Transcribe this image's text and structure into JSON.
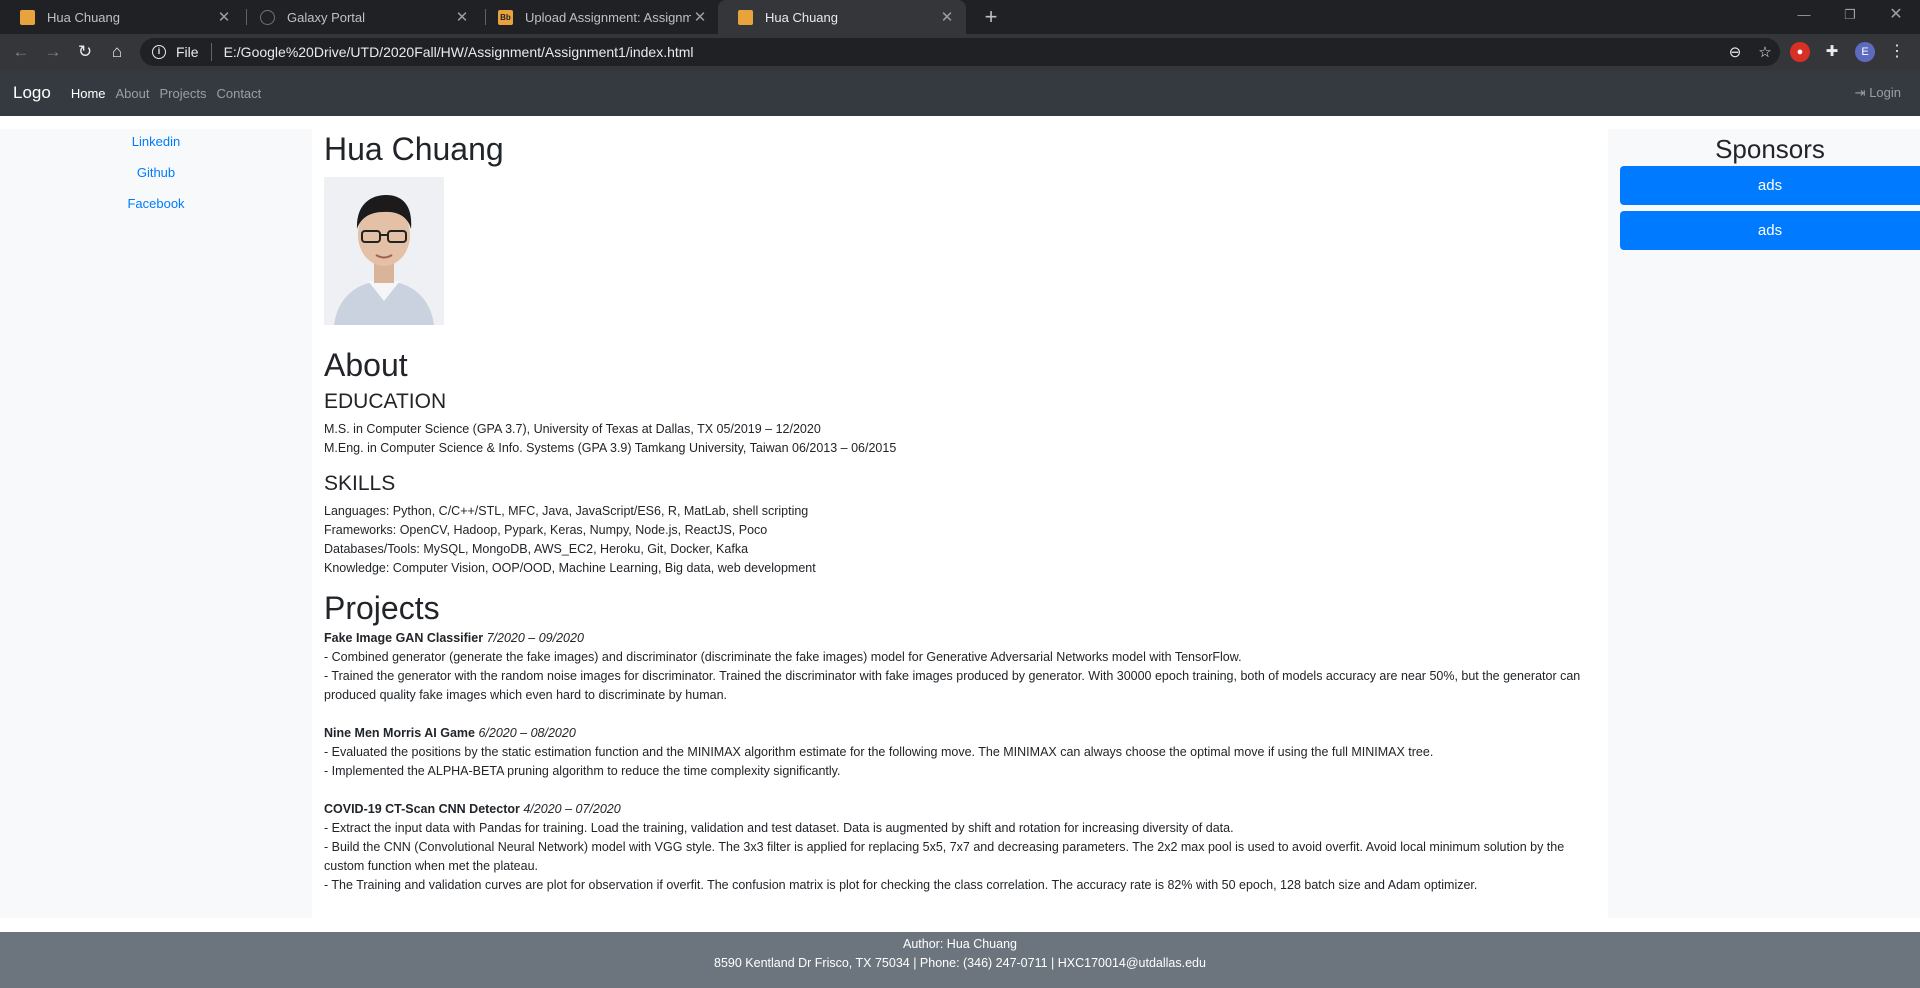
{
  "browser": {
    "tabs": [
      {
        "title": "Hua Chuang",
        "favicon": "html-file-icon",
        "active": false
      },
      {
        "title": "Galaxy Portal",
        "favicon": "globe-icon",
        "active": false
      },
      {
        "title": "Upload Assignment: Assignment",
        "favicon": "blackboard-icon",
        "active": false
      },
      {
        "title": "Hua Chuang",
        "favicon": "html-file-icon",
        "active": true
      }
    ],
    "bb_favicon_text": "Bb",
    "address": {
      "scheme_label": "File",
      "url": "E:/Google%20Drive/UTD/2020Fall/HW/Assignment/Assignment1/index.html"
    },
    "profile_initial": "E"
  },
  "navbar": {
    "brand": "Logo",
    "links": [
      "Home",
      "About",
      "Projects",
      "Contact"
    ],
    "active_link": "Home",
    "login": "Login"
  },
  "sidebar": {
    "links": [
      "Linkedin",
      "Github",
      "Facebook"
    ]
  },
  "sponsors": {
    "title": "Sponsors",
    "ads": [
      "ads",
      "ads"
    ]
  },
  "main": {
    "name": "Hua Chuang",
    "about_heading": "About",
    "education_heading": "EDUCATION",
    "education": [
      "M.S. in Computer Science (GPA 3.7), University of Texas at Dallas, TX 05/2019 – 12/2020",
      "M.Eng. in Computer Science & Info. Systems (GPA 3.9) Tamkang University, Taiwan 06/2013 – 06/2015"
    ],
    "skills_heading": "SKILLS",
    "skills": [
      "Languages: Python, C/C++/STL, MFC, Java, JavaScript/ES6, R, MatLab, shell scripting",
      "Frameworks: OpenCV, Hadoop, Pypark, Keras, Numpy, Node.js, ReactJS, Poco",
      "Databases/Tools: MySQL, MongoDB, AWS_EC2, Heroku, Git, Docker, Kafka",
      "Knowledge: Computer Vision, OOP/OOD, Machine Learning, Big data, web development"
    ],
    "projects_heading": "Projects",
    "projects": [
      {
        "title": "Fake Image GAN Classifier",
        "date": "7/2020 – 09/2020",
        "points": [
          "- Combined generator (generate the fake images) and discriminator (discriminate the fake images) model for Generative Adversarial Networks model with TensorFlow.",
          "- Trained the generator with the random noise images for discriminator. Trained the discriminator with fake images produced by generator. With 30000 epoch training, both of models accuracy are near 50%, but the generator can produced quality fake images which even hard to discriminate by human."
        ]
      },
      {
        "title": "Nine Men Morris AI Game",
        "date": "6/2020 – 08/2020",
        "points": [
          "- Evaluated the positions by the static estimation function and the MINIMAX algorithm estimate for the following move. The MINIMAX can always choose the optimal move if using the full MINIMAX tree.",
          "- Implemented the ALPHA-BETA pruning algorithm to reduce the time complexity significantly."
        ]
      },
      {
        "title": "COVID-19 CT-Scan CNN Detector",
        "date": "4/2020 – 07/2020",
        "points": [
          "- Extract the input data with Pandas for training. Load the training, validation and test dataset. Data is augmented by shift and rotation for increasing diversity of data.",
          "- Build the CNN (Convolutional Neural Network) model with VGG style. The 3x3 filter is applied for replacing 5x5, 7x7 and decreasing parameters. The 2x2 max pool is used to avoid overfit. Avoid local minimum solution by the custom function when met the plateau.",
          "- The Training and validation curves are plot for observation if overfit. The confusion matrix is plot for checking the class correlation. The accuracy rate is 82% with 50 epoch, 128 batch size and Adam optimizer."
        ]
      }
    ]
  },
  "footer": {
    "author": "Author: Hua Chuang",
    "contact": "8590 Kentland Dr Frisco, TX 75034 | Phone: (346) 247-0711 | HXC170014@utdallas.edu"
  },
  "colors": {
    "navbar_bg": "#343a40",
    "link": "#007bff",
    "footer_bg": "#6c757d"
  }
}
